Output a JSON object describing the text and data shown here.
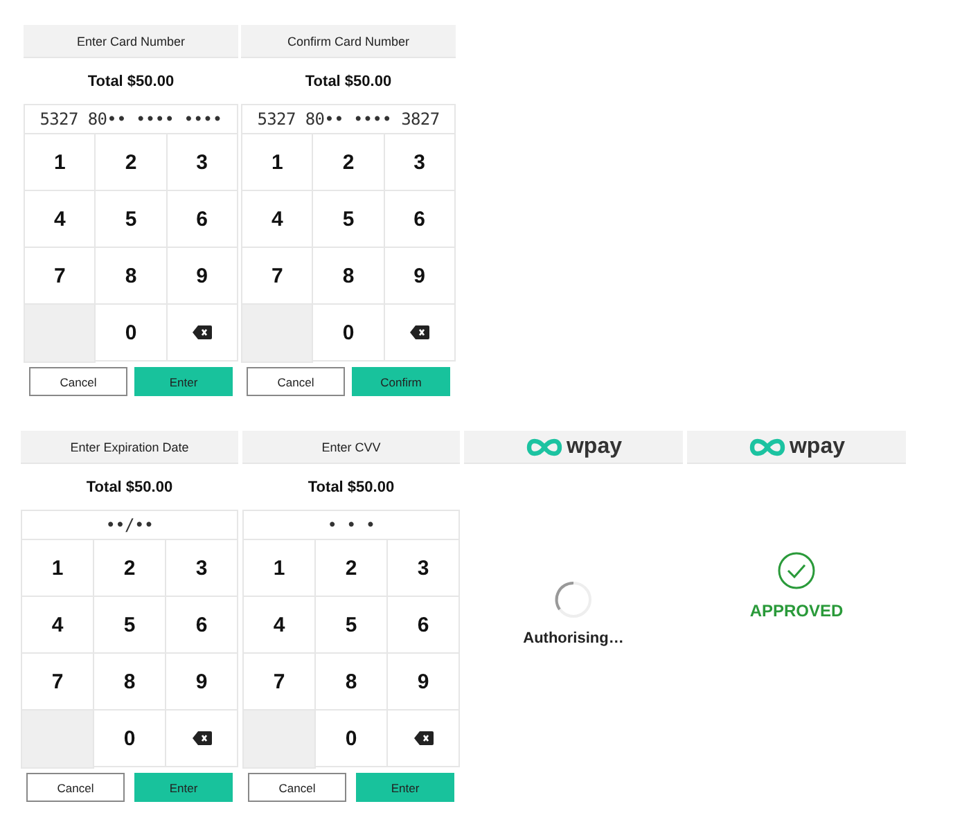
{
  "rows": [
    {
      "screens": [
        {
          "kind": "keypad",
          "title": "Enter Card Number",
          "total": "Total $50.00",
          "display": "5327 80•• •••• ••••",
          "keys": [
            {
              "kind": "digit",
              "label": "1"
            },
            {
              "kind": "digit",
              "label": "2"
            },
            {
              "kind": "digit",
              "label": "3"
            },
            {
              "kind": "digit",
              "label": "4"
            },
            {
              "kind": "digit",
              "label": "5"
            },
            {
              "kind": "digit",
              "label": "6"
            },
            {
              "kind": "digit",
              "label": "7"
            },
            {
              "kind": "digit",
              "label": "8"
            },
            {
              "kind": "digit",
              "label": "9"
            },
            {
              "kind": "blank"
            },
            {
              "kind": "digit",
              "label": "0"
            },
            {
              "kind": "backspace"
            }
          ],
          "buttons": [
            {
              "kind": "secondary",
              "label": "Cancel"
            },
            {
              "kind": "primary",
              "label": "Enter"
            }
          ]
        },
        {
          "kind": "keypad",
          "title": "Confirm Card Number",
          "total": "Total $50.00",
          "display": "5327 80•• •••• 3827",
          "keys": [
            {
              "kind": "digit",
              "label": "1"
            },
            {
              "kind": "digit",
              "label": "2"
            },
            {
              "kind": "digit",
              "label": "3"
            },
            {
              "kind": "digit",
              "label": "4"
            },
            {
              "kind": "digit",
              "label": "5"
            },
            {
              "kind": "digit",
              "label": "6"
            },
            {
              "kind": "digit",
              "label": "7"
            },
            {
              "kind": "digit",
              "label": "8"
            },
            {
              "kind": "digit",
              "label": "9"
            },
            {
              "kind": "blank"
            },
            {
              "kind": "digit",
              "label": "0"
            },
            {
              "kind": "backspace"
            }
          ],
          "buttons": [
            {
              "kind": "secondary",
              "label": "Cancel"
            },
            {
              "kind": "primary",
              "label": "Confirm"
            }
          ]
        }
      ]
    },
    {
      "screens": [
        {
          "kind": "keypad",
          "title": "Enter Expiration Date",
          "total": "Total $50.00",
          "display": "••/••",
          "keys": [
            {
              "kind": "digit",
              "label": "1"
            },
            {
              "kind": "digit",
              "label": "2"
            },
            {
              "kind": "digit",
              "label": "3"
            },
            {
              "kind": "digit",
              "label": "4"
            },
            {
              "kind": "digit",
              "label": "5"
            },
            {
              "kind": "digit",
              "label": "6"
            },
            {
              "kind": "digit",
              "label": "7"
            },
            {
              "kind": "digit",
              "label": "8"
            },
            {
              "kind": "digit",
              "label": "9"
            },
            {
              "kind": "blank"
            },
            {
              "kind": "digit",
              "label": "0"
            },
            {
              "kind": "backspace"
            }
          ],
          "buttons": [
            {
              "kind": "secondary",
              "label": "Cancel"
            },
            {
              "kind": "primary",
              "label": "Enter"
            }
          ]
        },
        {
          "kind": "keypad",
          "title": "Enter CVV",
          "total": "Total $50.00",
          "display": "• • •",
          "keys": [
            {
              "kind": "digit",
              "label": "1"
            },
            {
              "kind": "digit",
              "label": "2"
            },
            {
              "kind": "digit",
              "label": "3"
            },
            {
              "kind": "digit",
              "label": "4"
            },
            {
              "kind": "digit",
              "label": "5"
            },
            {
              "kind": "digit",
              "label": "6"
            },
            {
              "kind": "digit",
              "label": "7"
            },
            {
              "kind": "digit",
              "label": "8"
            },
            {
              "kind": "digit",
              "label": "9"
            },
            {
              "kind": "blank"
            },
            {
              "kind": "digit",
              "label": "0"
            },
            {
              "kind": "backspace"
            }
          ],
          "buttons": [
            {
              "kind": "secondary",
              "label": "Cancel"
            },
            {
              "kind": "primary",
              "label": "Enter"
            }
          ]
        },
        {
          "kind": "authorising",
          "logo": "wpay",
          "message": "Authorising…"
        },
        {
          "kind": "approved",
          "logo": "wpay",
          "message": "APPROVED"
        }
      ]
    }
  ]
}
